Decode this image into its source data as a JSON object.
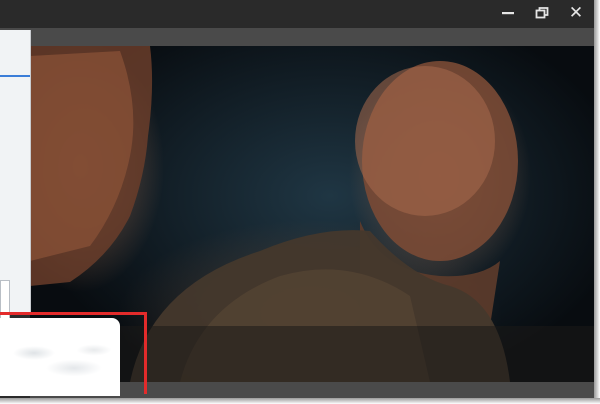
{
  "window": {
    "controls": {
      "minimize_icon": "minimize-icon",
      "maximize_icon": "restore-icon",
      "close_icon": "close-icon",
      "close_glyph": "✕"
    }
  },
  "video": {
    "description_icon": "video-frame"
  },
  "colors": {
    "titlebar": "#2a2a2a",
    "highlight": "#e32b2b",
    "side_accent": "#3b7dd8"
  }
}
